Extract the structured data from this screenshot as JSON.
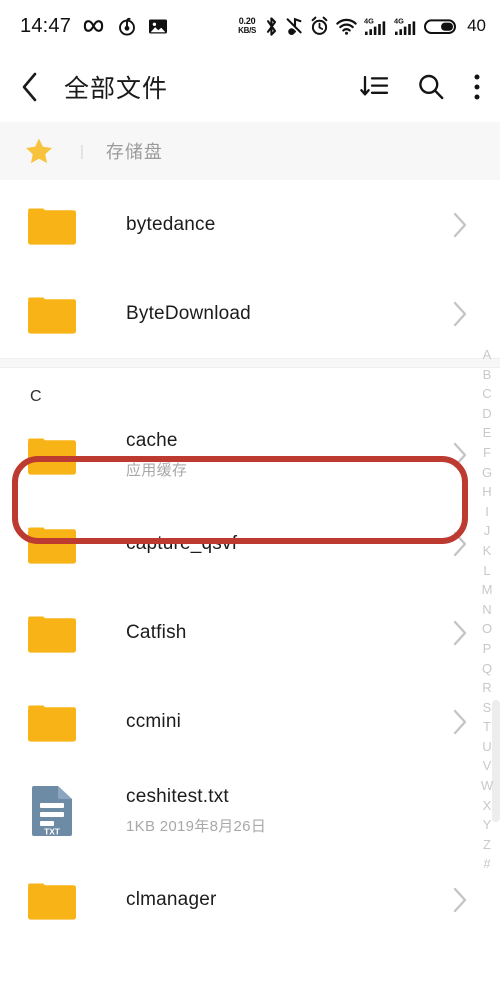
{
  "status_bar": {
    "time": "14:47",
    "left_icons": [
      "infinity-icon",
      "netease-music-icon",
      "screenshot-icon"
    ],
    "net_speed_value": "0.20",
    "net_speed_unit": "KB/S",
    "right_icons": [
      "bluetooth-icon",
      "mute-icon",
      "alarm-icon",
      "wifi-icon",
      "signal-4g-icon",
      "signal-4g-icon-2"
    ],
    "battery_level": "40"
  },
  "titlebar": {
    "back_label": "‹",
    "title": "全部文件",
    "actions": [
      {
        "name": "sort-button",
        "label": "sort-descending-icon"
      },
      {
        "name": "search-button",
        "label": "search-icon"
      },
      {
        "name": "more-button",
        "label": "more-vertical-icon"
      }
    ]
  },
  "breadcrumb": {
    "star_icon": "star-icon",
    "separator": "|",
    "path_item": "存储盘"
  },
  "list": {
    "rows": [
      {
        "type": "folder",
        "name": "bytedance",
        "sub": "",
        "chevron": true
      },
      {
        "type": "folder",
        "name": "ByteDownload",
        "sub": "",
        "chevron": true
      }
    ],
    "section_label": "C",
    "rows_section_c": [
      {
        "type": "folder",
        "name": "cache",
        "sub": "应用缓存",
        "chevron": true,
        "highlighted": true
      },
      {
        "type": "folder",
        "name": "capture_qsvf",
        "sub": "",
        "chevron": true,
        "highlighted": false
      },
      {
        "type": "folder",
        "name": "Catfish",
        "sub": "",
        "chevron": true,
        "highlighted": false
      },
      {
        "type": "folder",
        "name": "ccmini",
        "sub": "",
        "chevron": true,
        "highlighted": false
      },
      {
        "type": "txt",
        "name": "ceshitest.txt",
        "sub": "1KB   2019年8月26日",
        "chevron": false,
        "highlighted": false
      },
      {
        "type": "folder",
        "name": "clmanager",
        "sub": "",
        "chevron": true,
        "highlighted": false
      }
    ]
  },
  "alpha_index": {
    "letters": [
      "A",
      "B",
      "C",
      "D",
      "E",
      "F",
      "G",
      "H",
      "I",
      "J",
      "K",
      "L",
      "M",
      "N",
      "O",
      "P",
      "Q",
      "R",
      "S",
      "T",
      "U",
      "V",
      "W",
      "X",
      "Y",
      "Z",
      "#"
    ]
  },
  "colors": {
    "folder": "#F8B417",
    "txt_doc": "#6E8BA6",
    "annotation_red": "#bd3a30",
    "star": "#F7C33C",
    "breadcrumb_bg": "#f7f7f7"
  }
}
